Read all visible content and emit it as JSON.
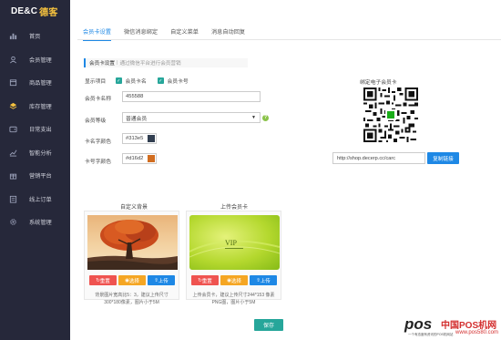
{
  "logo": {
    "text": "DE&C",
    "text_cn": "德客"
  },
  "sidebar": {
    "items": [
      {
        "label": "首页",
        "icon": "bar-chart-icon"
      },
      {
        "label": "会员管理",
        "icon": "user-icon"
      },
      {
        "label": "商品管理",
        "icon": "box-icon"
      },
      {
        "label": "库存管理",
        "icon": "layers-icon"
      },
      {
        "label": "日常支出",
        "icon": "wallet-icon"
      },
      {
        "label": "智能分析",
        "icon": "trend-icon"
      },
      {
        "label": "营销平台",
        "icon": "gift-icon"
      },
      {
        "label": "线上订单",
        "icon": "list-icon"
      },
      {
        "label": "系统管理",
        "icon": "gear-icon"
      }
    ]
  },
  "tabs": [
    {
      "label": "会员卡设置",
      "active": true
    },
    {
      "label": "微信消息绑定",
      "active": false
    },
    {
      "label": "自定义菜单",
      "active": false
    },
    {
      "label": "消息自动回复",
      "active": false
    }
  ],
  "section": {
    "title": "会员卡设置",
    "separator": "|",
    "hint": "通过微信平台进行会员营销"
  },
  "form": {
    "display_label": "显示项目",
    "show_card_name": "会员卡名",
    "show_card_no": "会员卡号",
    "name_label": "会员卡名称",
    "name_value": "455588",
    "level_label": "会员等级",
    "level_value": "普通会员",
    "name_color_label": "卡名字颜色",
    "name_color_value": "#313e5",
    "no_color_label": "卡号字颜色",
    "no_color_value": "#d16d2"
  },
  "colors": {
    "accent": "#1e88e5",
    "name_swatch": "#313e50",
    "no_swatch": "#d16d20",
    "sidebar_bg": "#26283a"
  },
  "qr": {
    "label": "绑定电子会员卡",
    "url": "http://shop.decerp.cc/carc",
    "copy_label": "复制链接"
  },
  "custom_bg": {
    "title": "自定义背景",
    "reset": "重置",
    "select": "选择",
    "upload": "上传",
    "desc": "背景图片宽高比5：3，建议上传尺寸300*180像素，图片小于5M"
  },
  "upload_card": {
    "title": "上传会员卡",
    "card_text": "VIP",
    "reset": "重置",
    "select": "选择",
    "upload": "上传",
    "desc": "上传会员卡，建议上传尺寸244*153 像素PNG图，图片小于5M"
  },
  "save_label": "保存",
  "watermark": {
    "pos": "pos",
    "cn": "中国POS机网",
    "url": "www.pos580.com",
    "slogan": "一个有态度有资讯的POS机网站"
  }
}
